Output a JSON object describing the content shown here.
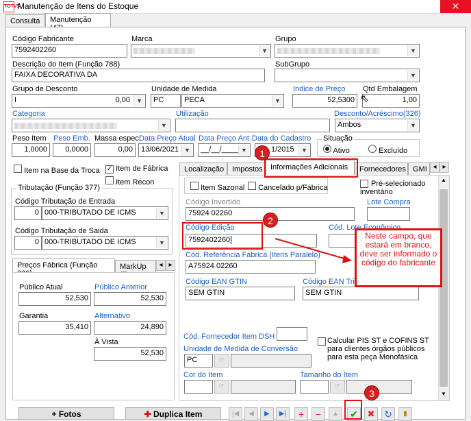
{
  "window": {
    "title": "Manutenção de Itens do Estoque",
    "app_icon_text": "TOTVS",
    "close_glyph": "✕"
  },
  "tabs": [
    {
      "label": "Consulta"
    },
    {
      "label": "Manutenção (47)"
    }
  ],
  "form": {
    "codigo_fabricante": {
      "label": "Código Fabricante",
      "value": "7592402260"
    },
    "marca": {
      "label": "Marca"
    },
    "grupo": {
      "label": "Grupo"
    },
    "descricao": {
      "label": "Descrição do Item (Função 788)",
      "value": "FAIXA DECORATIVA DA"
    },
    "subgrupo": {
      "label": "SubGrupo"
    },
    "grupo_desconto": {
      "label": "Grupo de Desconto",
      "code": "I",
      "value": "0,00"
    },
    "unidade_medida": {
      "label": "Unidade de Medida",
      "code": "PC",
      "value": "PECA"
    },
    "indice_preco": {
      "label": "Indice de Preço",
      "value": "52,5300"
    },
    "qtd_embalagem": {
      "label": "Qtd Embalagem",
      "value": "1,00"
    },
    "categoria": {
      "label": "Categoria"
    },
    "utilizacao": {
      "label": "Utilização"
    },
    "desconto_acrescimo": {
      "label": "Desconto/Acréscimo(326)",
      "value": "Ambos"
    },
    "peso_item": {
      "label": "Peso Item",
      "value": "1,0000"
    },
    "peso_emb": {
      "label": "Peso Emb.",
      "value": "0,0000"
    },
    "massa_espec": {
      "label": "Massa espec.",
      "value": "0,00"
    },
    "data_preco_atual": {
      "label": "Data Preço Atual",
      "value": "13/06/2021"
    },
    "data_preco_ant": {
      "label": "Data Preço Ant.",
      "value": "__/__/____"
    },
    "data_cadastro": {
      "label": "Data do Cadastro",
      "value": "1/2015"
    },
    "situacao": {
      "label": "Situação",
      "opt1": "Ativo",
      "opt2": "Excluído"
    }
  },
  "left": {
    "item_base_troca": "Item na Base da Troca",
    "item_fabrica": "Item de Fábrica",
    "item_recon": "Item Recon",
    "tributacao_title": "Tributação (Função 377)",
    "trib_entrada_label": "Código Tributação de Entrada",
    "trib_entrada_code": "0",
    "trib_entrada_value": "000-TRIBUTADO DE ICMS",
    "trib_saida_label": "Código Tributação de Saida",
    "trib_saida_code": "0",
    "trib_saida_value": "000-TRIBUTADO DE ICMS",
    "tab_precos": "Preços Fábrica (Função 326)",
    "tab_markup": "MarkUp (Fu",
    "publico_atual_label": "Público Atual",
    "publico_atual": "52,530",
    "publico_anterior_label": "Público Anterior",
    "publico_anterior": "52,530",
    "garantia_label": "Garantia",
    "garantia": "35,410",
    "alternativo_label": "Alternativo",
    "alternativo": "24,890",
    "a_vista_label": "À Vista",
    "a_vista": "52,530"
  },
  "right_tabs": [
    "Localização",
    "Impostos",
    "Informações Adicionais",
    "Fornecedores",
    "GMI"
  ],
  "info": {
    "item_sazonal": "Item Sazonal",
    "cancelado": "Cancelado p/Fábrica",
    "pre_selecionado": "Pré-selecionado inventário",
    "codigo_invertido_label": "Código Invertido",
    "codigo_invertido": "75924 02260",
    "lote_compra_label": "Lote Compra",
    "codigo_edicao_label": "Código Edição",
    "codigo_edicao": "7592402260",
    "lote_economico_label": "Cód. Lote Econômico",
    "ref_fabrica_label": "Cód. Referência Fábrica (Itens Paralelo)",
    "ref_fabrica": "A75924 02260",
    "ean_label": "Código EAN GTIN",
    "ean": "SEM GTIN",
    "ean_trib_label": "Código EAN Trib GTIN",
    "ean_trib": "SEM GTIN",
    "fornecedor_dsh_label": "Cód. Fornecedor Item DSH",
    "calcular_pis": "Calcular PIS ST e COFINS ST para clientes órgãos públicos para esta peça Monofásica",
    "unidade_conversao_label": "Unidade de Medida de Conversão",
    "unidade_conversao": "PC",
    "cor_label": "Cor do Item",
    "tamanho_label": "Tamanho do Item"
  },
  "annotation": {
    "text": "Neste campo, que estará em branco, deve ser informado o código do fabricante",
    "markers": [
      "1",
      "2",
      "3"
    ]
  },
  "bottom": {
    "fotos": "+ Fotos",
    "duplica": "Duplica Item"
  }
}
